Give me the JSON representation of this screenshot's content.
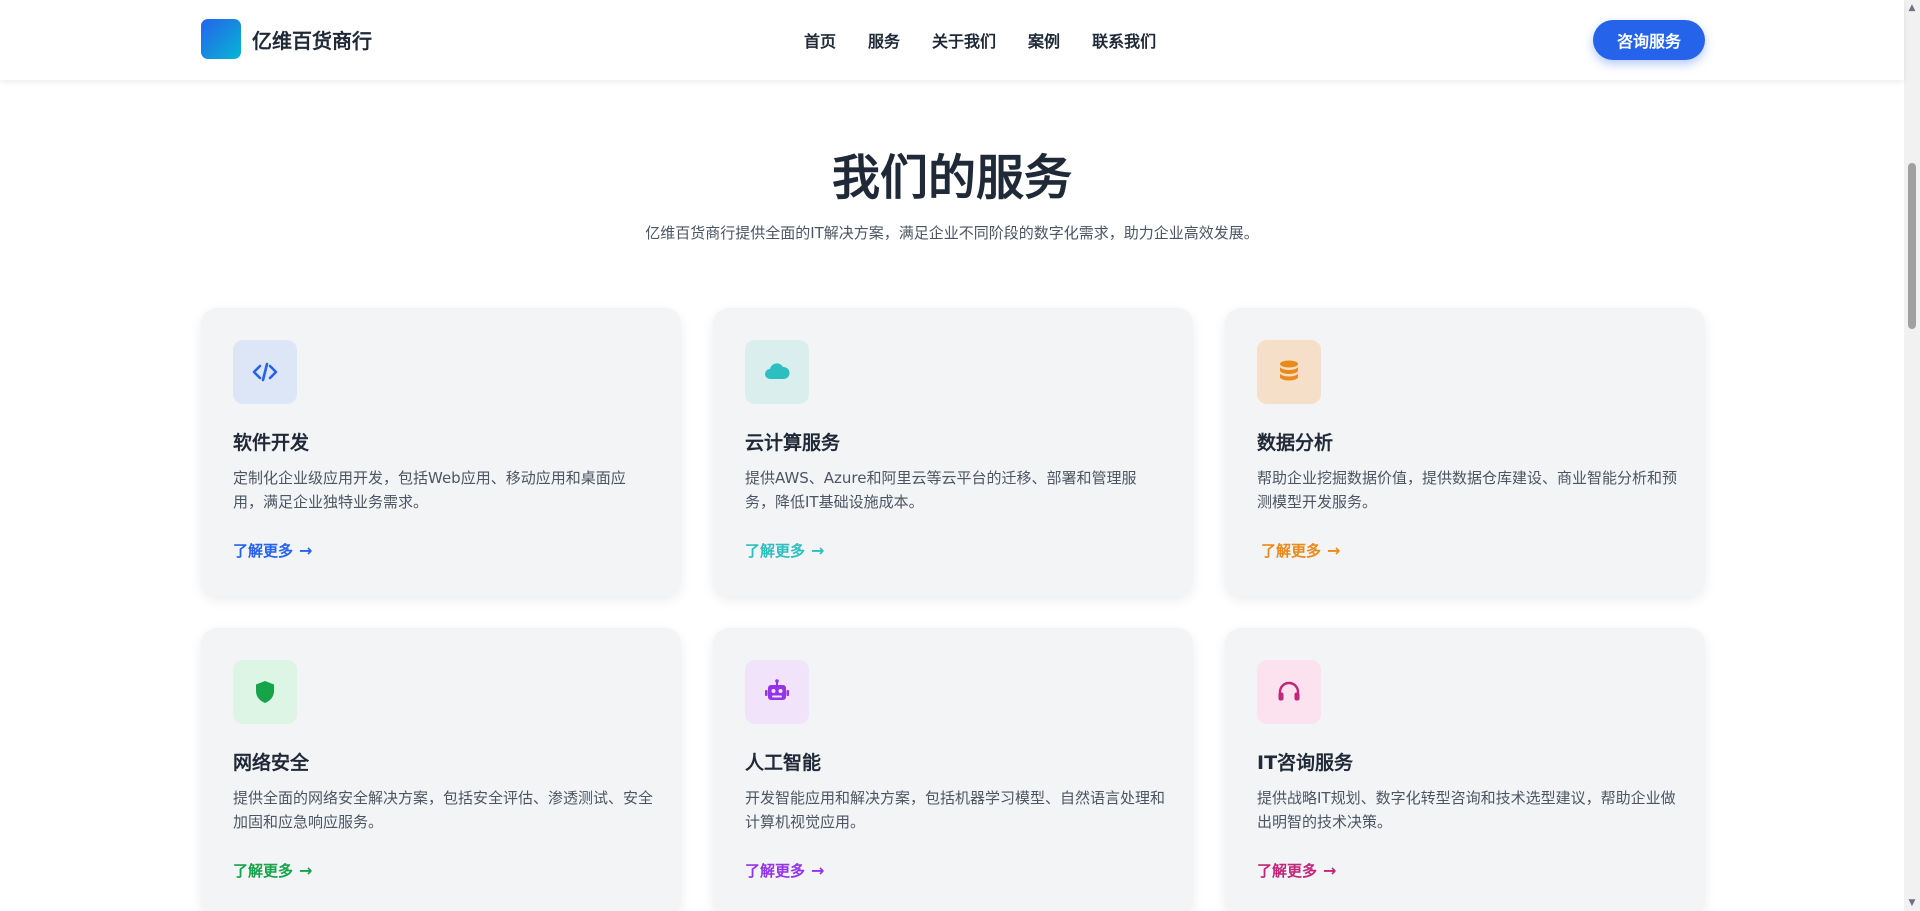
{
  "header": {
    "brand": "亿维百货商行",
    "nav": [
      "首页",
      "服务",
      "关于我们",
      "案例",
      "联系我们"
    ],
    "cta": "咨询服务"
  },
  "services": {
    "title": "我们的服务",
    "subtitle": "亿维百货商行提供全面的IT解决方案，满足企业不同阶段的数字化需求，助力企业高效发展。",
    "cards": [
      {
        "icon": "code-icon",
        "title": "软件开发",
        "description": "定制化企业级应用开发，包括Web应用、移动应用和桌面应用，满足企业独特业务需求。",
        "link": "了解更多",
        "accent": "#2563eb",
        "icon_bg": "#dde6f6"
      },
      {
        "icon": "cloud-icon",
        "title": "云计算服务",
        "description": "提供AWS、Azure和阿里云等云平台的迁移、部署和管理服务，降低IT基础设施成本。",
        "link": "了解更多",
        "accent": "#2dbfbf",
        "icon_bg": "#dbeeee"
      },
      {
        "icon": "database-icon",
        "title": "数据分析",
        "description": "帮助企业挖掘数据价值，提供数据仓库建设、商业智能分析和预测模型开发服务。",
        "link": "了解更多",
        "accent": "#ea8a1a",
        "icon_bg": "#f5dfc9"
      },
      {
        "icon": "shield-icon",
        "title": "网络安全",
        "description": "提供全面的网络安全解决方案，包括安全评估、渗透测试、安全加固和应急响应服务。",
        "link": "了解更多",
        "accent": "#16a34a",
        "icon_bg": "#dcf5e4"
      },
      {
        "icon": "robot-icon",
        "title": "人工智能",
        "description": "开发智能应用和解决方案，包括机器学习模型、自然语言处理和计算机视觉应用。",
        "link": "了解更多",
        "accent": "#9333ea",
        "icon_bg": "#f1e3fa"
      },
      {
        "icon": "headset-icon",
        "title": "IT咨询服务",
        "description": "提供战略IT规划、数字化转型咨询和技术选型建议，帮助企业做出明智的技术决策。",
        "link": "了解更多",
        "accent": "#c0267a",
        "icon_bg": "#fbe2ee"
      }
    ]
  }
}
